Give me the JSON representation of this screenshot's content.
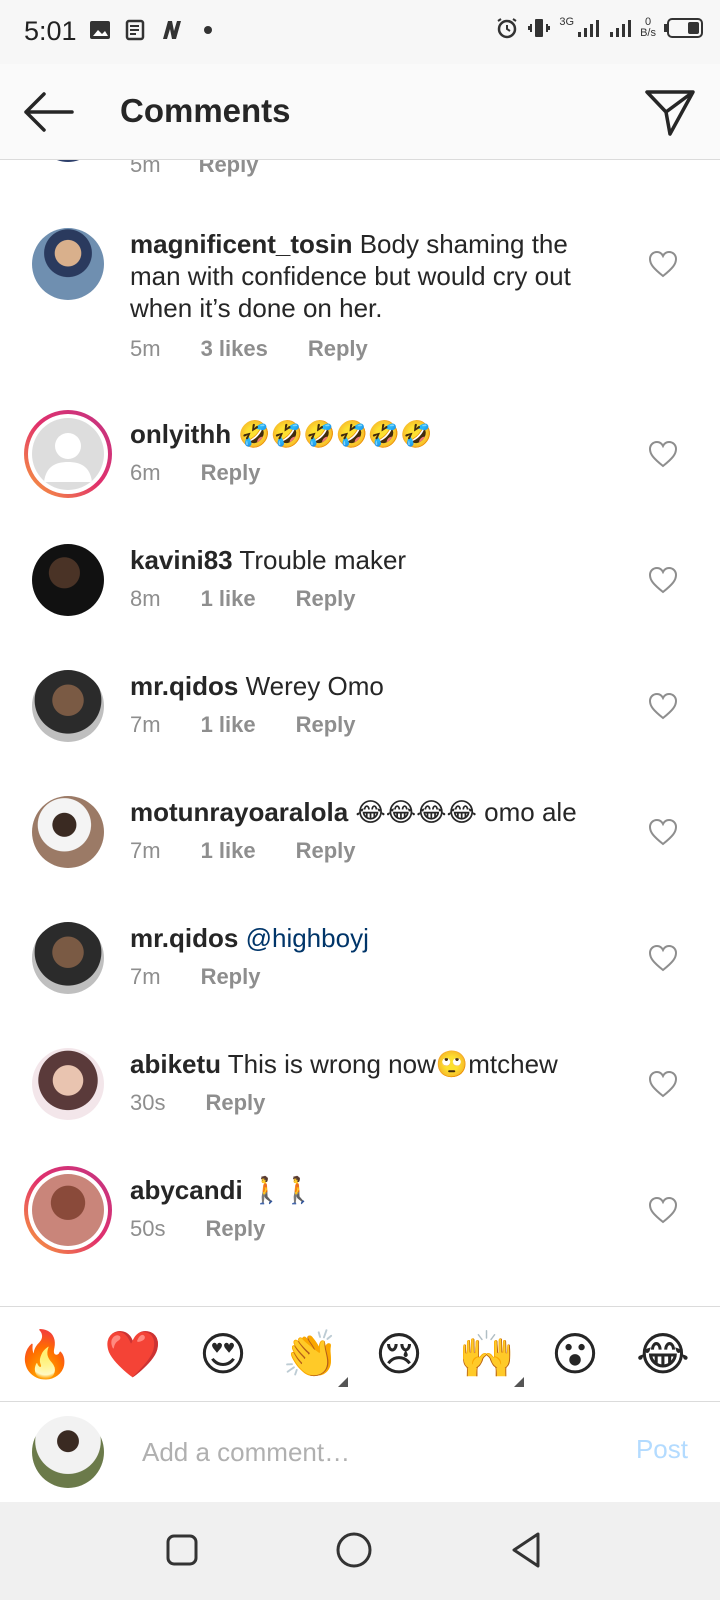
{
  "status_bar": {
    "time": "5:01",
    "network_label": "3G",
    "speed_value": "0",
    "speed_unit": "B/s"
  },
  "header": {
    "title": "Comments"
  },
  "partial_comment": {
    "time": "5m",
    "reply": "Reply"
  },
  "comments": [
    {
      "username": "magnificent_tosin",
      "text": "Body shaming the man with confidence but would cry out when it’s done on her.",
      "time": "5m",
      "likes": "3 likes",
      "reply": "Reply"
    },
    {
      "username": "onlyithh",
      "text": "🤣🤣🤣🤣🤣🤣",
      "time": "6m",
      "likes": "",
      "reply": "Reply"
    },
    {
      "username": "kavini83",
      "text": "Trouble maker",
      "time": "8m",
      "likes": "1 like",
      "reply": "Reply"
    },
    {
      "username": "mr.qidos",
      "text": "Werey Omo",
      "time": "7m",
      "likes": "1 like",
      "reply": "Reply"
    },
    {
      "username": "motunrayoaralola",
      "text": "😂😂😂😂 omo ale",
      "time": "7m",
      "likes": "1 like",
      "reply": "Reply"
    },
    {
      "username": "mr.qidos",
      "text": "@highboyj",
      "time": "7m",
      "likes": "",
      "reply": "Reply"
    },
    {
      "username": "abiketu",
      "text": "This is wrong now🙄mtchew",
      "time": "30s",
      "likes": "",
      "reply": "Reply"
    },
    {
      "username": "abycandi",
      "text": "🚶🚶",
      "time": "50s",
      "likes": "",
      "reply": "Reply"
    }
  ],
  "emoji_bar": [
    "🔥",
    "❤️",
    "😍",
    "👏",
    "😢",
    "🙌",
    "😮",
    "😂"
  ],
  "composer": {
    "placeholder": "Add a comment…",
    "post_label": "Post"
  },
  "colors": {
    "mention": "#003569",
    "post_disabled": "#b3dbff",
    "meta_gray": "#8e8e8e"
  }
}
